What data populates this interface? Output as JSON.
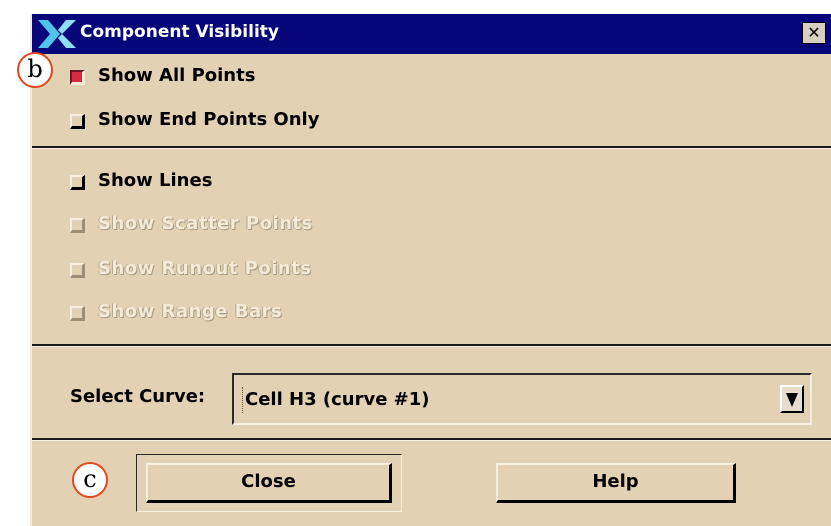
{
  "window": {
    "title": "Component Visibility",
    "close_glyph": "✕",
    "logo_icon": "x-logo-icon"
  },
  "options_group1": [
    {
      "label": "Show All Points",
      "checked": true,
      "enabled": true
    },
    {
      "label": "Show End Points Only",
      "checked": false,
      "enabled": true
    }
  ],
  "options_group2": [
    {
      "label": "Show Lines",
      "checked": false,
      "enabled": true
    },
    {
      "label": "Show Scatter Points",
      "checked": false,
      "enabled": false
    },
    {
      "label": "Show Runout Points",
      "checked": false,
      "enabled": false
    },
    {
      "label": "Show Range Bars",
      "checked": false,
      "enabled": false
    }
  ],
  "select_curve": {
    "label": "Select Curve:",
    "value": "Cell H3 (curve #1)",
    "arrow_icon": "down-arrow-icon"
  },
  "buttons": {
    "close": "Close",
    "help": "Help"
  },
  "annotations": {
    "b": "b",
    "c": "c"
  },
  "colors": {
    "title_bar": "#06067a",
    "dialog_bg": "#e2d1b2",
    "checked_indicator": "#d82a3e",
    "callout_border": "#e0491e"
  }
}
